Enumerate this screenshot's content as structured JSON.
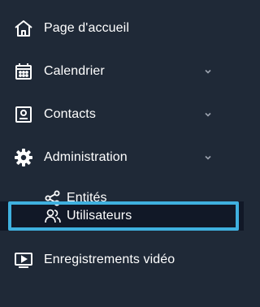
{
  "sidebar": {
    "items": [
      {
        "label": "Page d'accueil",
        "icon": "home-icon",
        "expandable": false
      },
      {
        "label": "Calendrier",
        "icon": "calendar-icon",
        "expandable": true
      },
      {
        "label": "Contacts",
        "icon": "contact-card-icon",
        "expandable": true
      },
      {
        "label": "Administration",
        "icon": "gear-icon",
        "expandable": true,
        "expanded": true
      },
      {
        "label": "Entités",
        "icon": "share-nodes-icon",
        "sub": true
      },
      {
        "label": "Utilisateurs",
        "icon": "users-icon",
        "sub": true,
        "selected": true
      },
      {
        "label": "Enregistrements vidéo",
        "icon": "video-screen-icon",
        "expandable": false
      }
    ]
  },
  "colors": {
    "background": "#1f2937",
    "selected_background": "#111827",
    "selected_outline": "#3fb0df",
    "text": "#ffffff",
    "chevron": "#9ca3af"
  }
}
